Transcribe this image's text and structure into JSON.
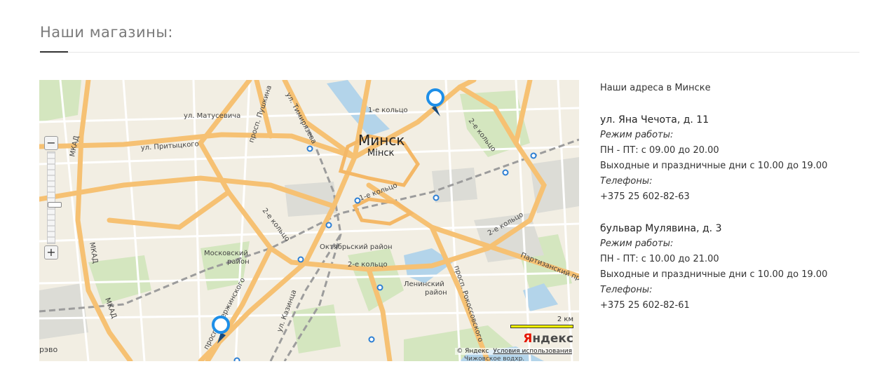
{
  "page": {
    "title": "Наши магазины:"
  },
  "map": {
    "city_label": "Минск",
    "city_label_small": "Мінск",
    "labels": {
      "matusevicha": "ул. Матусевича",
      "pritytskogo": "ул. Притыцкого",
      "pushkina": "просп. Пушкина",
      "timiryazeva": "ул. Тимирязева",
      "mkad_1": "МКАД",
      "mkad_2": "МКАД",
      "mkad_3": "МКАД",
      "ring1_top": "1-е кольцо",
      "ring1_mid": "1-е кольцо",
      "ring2_west": "2-е кольцо",
      "ring2_ne": "2-е кольцо",
      "ring2_east": "2-е кольцо",
      "ring2_south": "2-е кольцо",
      "moskovsky_1": "Московский",
      "moskovsky_2": "район",
      "oktyabrsky": "Октябрьский район",
      "leninsky_1": "Ленинский",
      "leninsky_2": "район",
      "partizansky": "Партизанский пр",
      "rokossovskogo": "просп. Рокоссовского",
      "dzerzhinskogo": "просп. Дзержинского",
      "kazintsa": "ул. Казинца",
      "revo": "рэво",
      "chizhovskoe": "Чижовское водхр."
    },
    "zoom": {
      "zoom_out": "−",
      "zoom_in": "+",
      "level": 0.43
    },
    "scale_label": "2 км",
    "logo_ya": "Я",
    "logo_rest": "ндекс",
    "copyright": "© Яндекс",
    "terms_link": "Условия использования",
    "colors": {
      "background": "#f2eee3",
      "major_road": "#f7c16b",
      "minor_road": "#ffffff",
      "park": "#cfe4b8",
      "water": "#a9cfe8",
      "rail": "#9a9a9a",
      "metro": "#2d7fd3",
      "pin": "#1e8fe8",
      "pin_tail": "#1a4a7a"
    }
  },
  "info": {
    "heading": "Наши адреса в Минске",
    "stores": [
      {
        "address": "ул. Яна Чечота, д. 11",
        "hours_label": "Режим работы:",
        "weekday_hours": "ПН - ПТ: с 09.00 до 20.00",
        "weekend_hours": "Выходные и праздничные дни с 10.00 до 19.00",
        "phones_label": "Телефоны:",
        "phone": "+375 25 602-82-63"
      },
      {
        "address": "бульвар Мулявина, д. 3",
        "hours_label": "Режим работы:",
        "weekday_hours": "ПН - ПТ: с 10.00 до 21.00",
        "weekend_hours": "Выходные и праздничные дни с 10.00 до 19.00",
        "phones_label": "Телефоны:",
        "phone": "+375 25 602-82-61"
      }
    ]
  }
}
